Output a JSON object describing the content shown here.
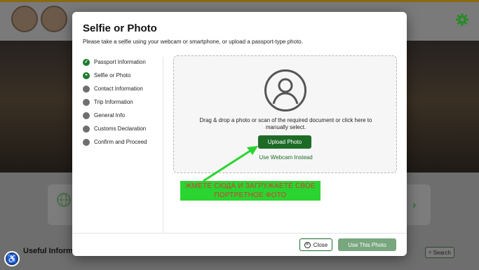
{
  "background": {
    "useful_info_label": "Useful Informat",
    "search_label": "Search"
  },
  "modal": {
    "title": "Selfie or Photo",
    "subtitle": "Please take a selfie using your webcam or smartphone, or upload a passport-type photo.",
    "steps": [
      {
        "label": "Passport Information",
        "status": "done"
      },
      {
        "label": "Selfie or Photo",
        "status": "current"
      },
      {
        "label": "Contact Information",
        "status": "todo"
      },
      {
        "label": "Trip Information",
        "status": "todo"
      },
      {
        "label": "General Info",
        "status": "todo"
      },
      {
        "label": "Customs Declaration",
        "status": "todo"
      },
      {
        "label": "Confirm and Proceed",
        "status": "todo"
      }
    ],
    "dropzone": {
      "instruction": "Drag & drop a photo or scan of the required document or click here to manually select.",
      "upload_label": "Upload Photo",
      "webcam_label": "Use Webcam Instead"
    },
    "footer": {
      "close_label": "Close",
      "use_label": "Use This Photo"
    }
  },
  "annotation": {
    "text": "ЖМЕТЕ СЮДА И ЗАГРУЖАЕТЕ СВОЕ ПОРТРЕТНОЕ ФОТО"
  },
  "colors": {
    "primary_green": "#1e6b27",
    "disabled_green": "#78a67e",
    "annotation_bg": "#2bd430",
    "annotation_text": "#d73a3a"
  }
}
